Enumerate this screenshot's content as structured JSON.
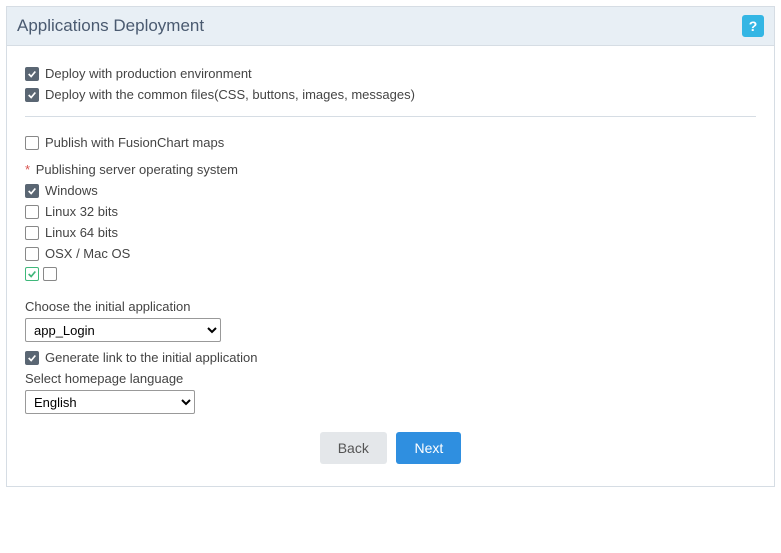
{
  "header": {
    "title": "Applications Deployment",
    "help_glyph": "?"
  },
  "top_options": {
    "deploy_prod": {
      "label": "Deploy with production environment",
      "checked": true
    },
    "deploy_common": {
      "label": "Deploy with the common files(CSS, buttons, images, messages)",
      "checked": true
    }
  },
  "fusionchart": {
    "label": "Publish with FusionChart maps",
    "checked": false
  },
  "os_section": {
    "label": "Publishing server operating system",
    "options": {
      "windows": {
        "label": "Windows",
        "checked": true
      },
      "linux32": {
        "label": "Linux 32 bits",
        "checked": false
      },
      "linux64": {
        "label": "Linux 64 bits",
        "checked": false
      },
      "osx": {
        "label": "OSX / Mac OS",
        "checked": false
      }
    },
    "extra": {
      "first_checked": true,
      "second_checked": false
    }
  },
  "initial_app": {
    "label": "Choose the initial application",
    "value": "app_Login"
  },
  "gen_link": {
    "label": "Generate link to the initial application",
    "checked": true
  },
  "homepage_lang": {
    "label": "Select homepage language",
    "value": "English"
  },
  "footer": {
    "back": "Back",
    "next": "Next"
  }
}
